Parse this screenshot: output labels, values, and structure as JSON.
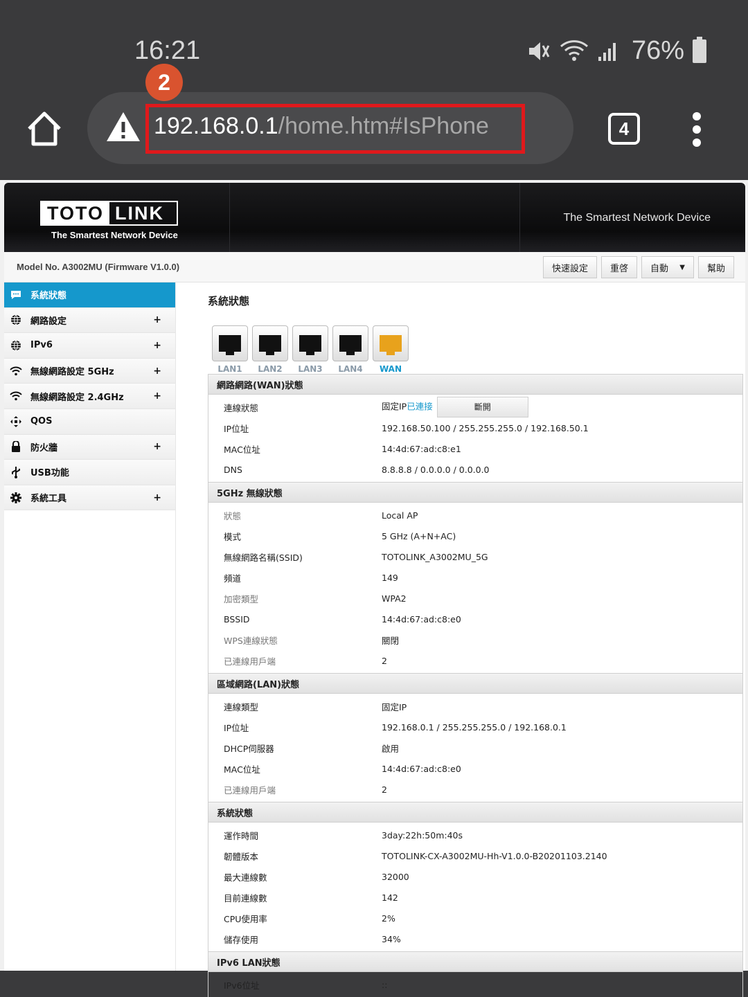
{
  "status_bar": {
    "time": "16:21",
    "battery": "76%"
  },
  "browser": {
    "url_host": "192.168.0.1",
    "url_path": "/home.htm#IsPhone",
    "tab_count": "4",
    "annotation_badge": "2"
  },
  "router": {
    "logo_left": "TOTO",
    "logo_right": "LINK",
    "logo_tagline": "The Smartest Network Device",
    "banner_tagline": "The Smartest Network Device",
    "model": "Model No. A3002MU (Firmware V1.0.0)",
    "buttons": {
      "quick_setup": "快速設定",
      "reboot": "重啓",
      "language": "自動",
      "help": "幫助"
    },
    "sidebar": [
      {
        "label": "系統狀態",
        "icon": "chat-icon",
        "plus": ""
      },
      {
        "label": "網路設定",
        "icon": "globe-icon",
        "plus": "+"
      },
      {
        "label": "IPv6",
        "icon": "globe-icon",
        "plus": "+"
      },
      {
        "label": "無線網路設定 5GHz",
        "icon": "wifi-icon",
        "plus": "+"
      },
      {
        "label": "無線網路設定 2.4GHz",
        "icon": "wifi-icon",
        "plus": "+"
      },
      {
        "label": "QOS",
        "icon": "arrows-icon",
        "plus": ""
      },
      {
        "label": "防火牆",
        "icon": "lock-icon",
        "plus": "+"
      },
      {
        "label": "USB功能",
        "icon": "usb-icon",
        "plus": ""
      },
      {
        "label": "系統工具",
        "icon": "gear-icon",
        "plus": "+"
      }
    ],
    "content_title": "系統狀態",
    "ports": [
      "LAN1",
      "LAN2",
      "LAN3",
      "LAN4",
      "WAN"
    ],
    "wan": {
      "header": "網路網路(WAN)狀態",
      "rows": [
        {
          "k": "連線狀態",
          "v": "固定IP",
          "v_link": "已連接",
          "button": "斷開"
        },
        {
          "k": "IP位址",
          "v": "192.168.50.100 / 255.255.255.0 / 192.168.50.1"
        },
        {
          "k": "MAC位址",
          "v": "14:4d:67:ad:c8:e1"
        },
        {
          "k": "DNS",
          "v": "8.8.8.8 / 0.0.0.0 / 0.0.0.0"
        }
      ]
    },
    "wifi5g": {
      "header": "5GHz 無線狀態",
      "rows": [
        {
          "k": "狀態",
          "v": "Local AP"
        },
        {
          "k": "模式",
          "v": "5 GHz (A+N+AC)"
        },
        {
          "k": "無線網路名稱(SSID)",
          "v": "TOTOLINK_A3002MU_5G"
        },
        {
          "k": "頻道",
          "v": "149"
        },
        {
          "k": "加密類型",
          "v": "WPA2"
        },
        {
          "k": "BSSID",
          "v": "14:4d:67:ad:c8:e0"
        },
        {
          "k": "WPS連線狀態",
          "v": "關閉"
        },
        {
          "k": "已連線用戶端",
          "v": "2"
        }
      ]
    },
    "lan": {
      "header": "區域網路(LAN)狀態",
      "rows": [
        {
          "k": "連線類型",
          "v": "固定IP"
        },
        {
          "k": "IP位址",
          "v": "192.168.0.1 / 255.255.255.0 / 192.168.0.1"
        },
        {
          "k": "DHCP伺服器",
          "v": "啟用"
        },
        {
          "k": "MAC位址",
          "v": "14:4d:67:ad:c8:e0"
        },
        {
          "k": "已連線用戶端",
          "v": "2"
        }
      ]
    },
    "system": {
      "header": "系統狀態",
      "rows": [
        {
          "k": "運作時間",
          "v": "3day:22h:50m:40s"
        },
        {
          "k": "韌體版本",
          "v": "TOTOLINK-CX-A3002MU-Hh-V1.0.0-B20201103.2140"
        },
        {
          "k": "最大連線數",
          "v": "32000"
        },
        {
          "k": "目前連線數",
          "v": "142"
        },
        {
          "k": "CPU使用率",
          "v": "2%"
        },
        {
          "k": "儲存使用",
          "v": "34%"
        }
      ]
    },
    "ipv6": {
      "header": "IPv6 LAN狀態",
      "rows": [
        {
          "k": "IPv6位址",
          "v": "::"
        }
      ]
    }
  }
}
